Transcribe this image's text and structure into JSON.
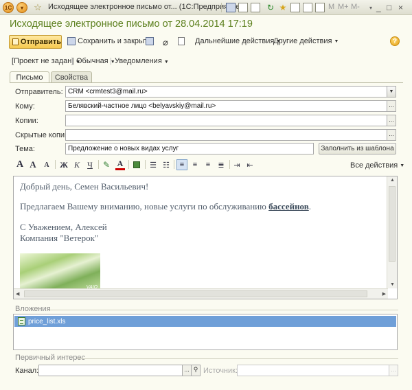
{
  "titlebar": {
    "title": "Исходящее электронное письмо от...  (1С:Предприятие)",
    "m_labels": [
      "M",
      "M+",
      "M-"
    ],
    "window_buttons": [
      "_",
      "□",
      "×"
    ]
  },
  "document": {
    "title": "Исходящее электронное письмо от 28.04.2014 17:19"
  },
  "toolbar": {
    "send_label": "Отправить",
    "save_close_label": "Сохранить и закрыть",
    "further_actions_label": "Дальнейшие действия",
    "other_actions_label": "Другие действия",
    "help_label": "?"
  },
  "meta": {
    "project": "[Проект не задан]",
    "importance": "Обычная",
    "notifications": "Уведомления"
  },
  "tabs": [
    {
      "label": "Письмо",
      "active": true
    },
    {
      "label": "Свойства",
      "active": false
    }
  ],
  "form": {
    "sender_label": "Отправитель:",
    "sender_value": "CRM <crmtest3@mail.ru>",
    "to_label": "Кому:",
    "to_value": "Белявский-частное лицо <belyavskiy@mail.ru>",
    "cc_label": "Копии:",
    "cc_value": "",
    "bcc_label": "Скрытые копии:",
    "bcc_value": "",
    "subject_label": "Тема:",
    "subject_value": "Предложение о новых видах услуг",
    "fill_template_label": "Заполнить из шаблона",
    "ellipsis": "..."
  },
  "format_toolbar": {
    "all_actions_label": "Все действия"
  },
  "editor": {
    "line1": "Добрый день, Семен Васильевич!",
    "line2_prefix": "Предлагаем Вашему вниманию, новые услуги по обслуживанию ",
    "line2_bold": "бассейнов",
    "line2_suffix": ".",
    "line3": "С Уважением, Алексей",
    "line4": "Компания \"Ветерок\"",
    "image_text": "VAIO"
  },
  "attachments": {
    "label": "Вложения",
    "files": [
      "price_list.xls"
    ]
  },
  "primary_interest": {
    "label": "Первичный интерес",
    "channel_label": "Канал:",
    "channel_value": "",
    "source_label": "Источник:",
    "source_value": ""
  },
  "colors": {
    "title_green": "#5b7f1c",
    "send_button": "#f6c94f",
    "selection_blue": "#6f9fd8"
  }
}
